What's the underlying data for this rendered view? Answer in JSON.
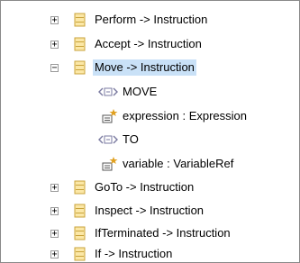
{
  "tree": {
    "types": [
      {
        "label": "Perform -> Instruction",
        "expanded": false
      },
      {
        "label": "Accept -> Instruction",
        "expanded": false
      },
      {
        "label": "Move -> Instruction",
        "expanded": true,
        "selected": true
      },
      {
        "label": "GoTo -> Instruction",
        "expanded": false
      },
      {
        "label": "Inspect -> Instruction",
        "expanded": false
      },
      {
        "label": "IfTerminated -> Instruction",
        "expanded": false
      },
      {
        "label": "If -> Instruction",
        "expanded": false
      }
    ],
    "move_children": [
      {
        "label": "MOVE",
        "kind": "keyword",
        "icon": "keyword-icon"
      },
      {
        "label": "expression : Expression",
        "kind": "attribute",
        "icon": "assignment-icon"
      },
      {
        "label": "TO",
        "kind": "keyword",
        "icon": "keyword-icon"
      },
      {
        "label": "variable : VariableRef",
        "kind": "attribute",
        "icon": "assignment-icon"
      }
    ]
  },
  "colors": {
    "selection": "#c9e1f7",
    "type_icon_fill": "#fbe7a6",
    "type_icon_stroke": "#c9a33b",
    "keyword_icon": "#7a7aa0",
    "assignment_icon": "#e0a020"
  }
}
